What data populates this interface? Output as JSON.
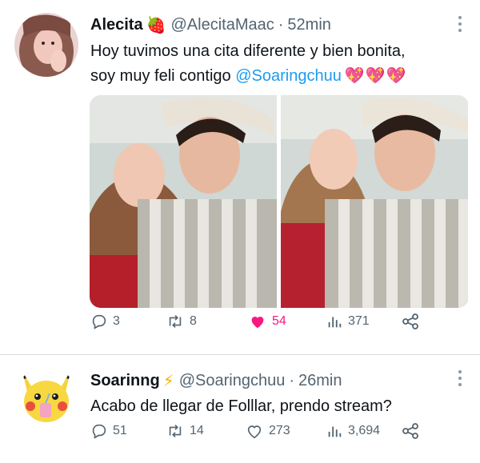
{
  "tweets": [
    {
      "name": "Alecita",
      "name_emoji": "🍓",
      "handle": "@AlecitaMaac",
      "separator": "·",
      "time": "52min",
      "text_line1": "Hoy tuvimos una cita diferente y bien bonita,",
      "text_line2_prefix": "soy muy feli contigo ",
      "mention": "@Soaringchuu",
      "hearts": "💖💖💖",
      "replies": "3",
      "retweets": "8",
      "likes": "54",
      "views": "371",
      "liked": true
    },
    {
      "name": "Soarinng",
      "name_emoji": "⚡",
      "handle": "@Soaringchuu",
      "separator": "·",
      "time": "26min",
      "text": "Acabo de llegar de Folllar, prendo stream?",
      "replies": "51",
      "retweets": "14",
      "likes": "273",
      "views": "3,694",
      "liked": false
    }
  ],
  "colors": {
    "text": "#0f1419",
    "secondary": "#536471",
    "mention": "#1d9bf0",
    "like": "#f91880",
    "divider": "#d8dde1"
  },
  "icons": [
    "reply-icon",
    "retweet-icon",
    "like-icon",
    "views-icon",
    "share-icon",
    "more-icon"
  ]
}
